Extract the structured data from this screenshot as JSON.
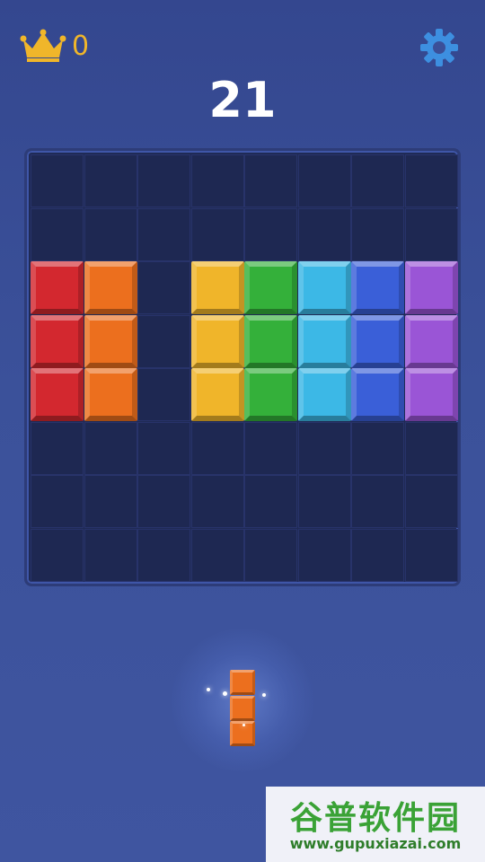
{
  "header": {
    "best_score": "0",
    "score": "21",
    "crown_icon": "crown-icon",
    "settings_icon": "gear-icon"
  },
  "colors": {
    "red": "#d3282f",
    "orange": "#ec6f1e",
    "yellow": "#f0b52a",
    "green": "#34b03a",
    "cyan": "#3cb8e6",
    "blue": "#3a5fd8",
    "purple": "#9a55d6",
    "crown": "#f0b62a",
    "gear": "#3d8fe0"
  },
  "board": {
    "cols": 8,
    "rows": 8,
    "filled": [
      {
        "row": 2,
        "col": 0,
        "color": "red"
      },
      {
        "row": 3,
        "col": 0,
        "color": "red"
      },
      {
        "row": 4,
        "col": 0,
        "color": "red"
      },
      {
        "row": 2,
        "col": 1,
        "color": "orange"
      },
      {
        "row": 3,
        "col": 1,
        "color": "orange"
      },
      {
        "row": 4,
        "col": 1,
        "color": "orange"
      },
      {
        "row": 2,
        "col": 3,
        "color": "yellow"
      },
      {
        "row": 3,
        "col": 3,
        "color": "yellow"
      },
      {
        "row": 4,
        "col": 3,
        "color": "yellow"
      },
      {
        "row": 2,
        "col": 4,
        "color": "green"
      },
      {
        "row": 3,
        "col": 4,
        "color": "green"
      },
      {
        "row": 4,
        "col": 4,
        "color": "green"
      },
      {
        "row": 2,
        "col": 5,
        "color": "cyan"
      },
      {
        "row": 3,
        "col": 5,
        "color": "cyan"
      },
      {
        "row": 4,
        "col": 5,
        "color": "cyan"
      },
      {
        "row": 2,
        "col": 6,
        "color": "blue"
      },
      {
        "row": 3,
        "col": 6,
        "color": "blue"
      },
      {
        "row": 4,
        "col": 6,
        "color": "blue"
      },
      {
        "row": 2,
        "col": 7,
        "color": "purple"
      },
      {
        "row": 3,
        "col": 7,
        "color": "purple"
      },
      {
        "row": 4,
        "col": 7,
        "color": "purple"
      }
    ]
  },
  "tray": {
    "pieces": [
      {
        "color": "orange",
        "cells": [
          [
            0,
            0
          ],
          [
            1,
            0
          ],
          [
            2,
            0
          ]
        ]
      }
    ]
  },
  "watermark": {
    "title": "谷普软件园",
    "url": "www.gupuxiazai.com"
  }
}
